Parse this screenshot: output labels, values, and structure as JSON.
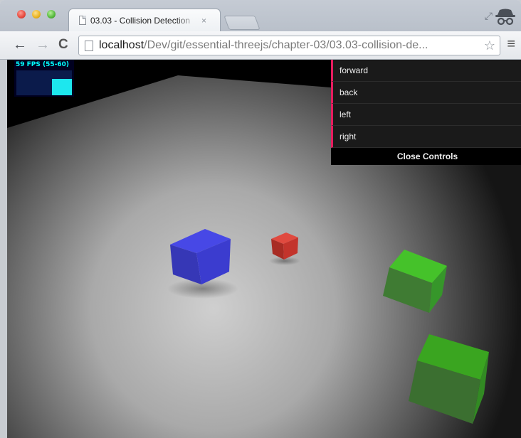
{
  "browser": {
    "tab_title": "03.03 - Collision Detection",
    "tab_close": "×",
    "url_host": "localhost",
    "url_path": "/Dev/git/essential-threejs/chapter-03/03.03-collision-de...",
    "icons": {
      "back": "back-arrow-icon",
      "forward": "forward-arrow-icon",
      "reload": "reload-icon",
      "star": "bookmark-star-icon",
      "menu": "hamburger-menu-icon",
      "incognito": "incognito-icon",
      "restore": "fullscreen-restore-icon"
    }
  },
  "stats": {
    "fps_text": "59 FPS (55-60)",
    "level": 0.65,
    "color": "#00ffff"
  },
  "controls": {
    "items": [
      {
        "label": "forward"
      },
      {
        "label": "back"
      },
      {
        "label": "left"
      },
      {
        "label": "right"
      }
    ],
    "close_label": "Close Controls",
    "accent": "#e61d5f"
  },
  "scene": {
    "objects": [
      {
        "name": "blue-cube",
        "color": "#3b3ccf"
      },
      {
        "name": "red-cube",
        "color": "#c3342c"
      },
      {
        "name": "green-cube-1",
        "color": "#3fae23"
      },
      {
        "name": "green-cube-2",
        "color": "#3aa520"
      }
    ]
  }
}
